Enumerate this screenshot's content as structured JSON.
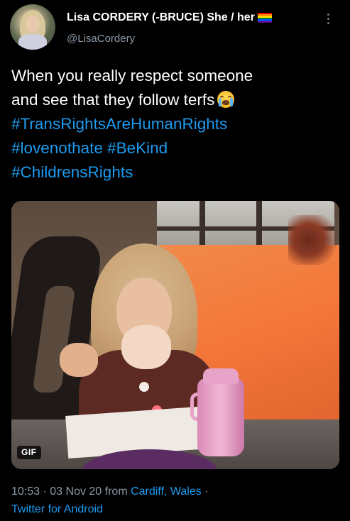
{
  "colors": {
    "background": "#000000",
    "text": "#ffffff",
    "muted": "#8b98a5",
    "link": "#1d9bf0"
  },
  "author": {
    "display_name": "Lisa CORDERY (-BRUCE) She / her",
    "handle": "@LisaCordery",
    "name_emoji": "rainbow-flag-icon"
  },
  "tweet": {
    "text_line1": "When you really respect someone",
    "text_line2_plain": "and see that they follow terfs",
    "text_line2_emoji": "loudly-crying-face-icon",
    "hashtags": [
      "#TransRightsAreHumanRights",
      "#lovenothate",
      "#BeKind",
      "#ChildrensRights"
    ]
  },
  "media": {
    "badge": "GIF"
  },
  "meta": {
    "time": "10:53",
    "separator1": " · ",
    "date": "03 Nov 20",
    "from_word": " from ",
    "location": "Cardiff, Wales",
    "separator2": " ·",
    "source": "Twitter for Android"
  }
}
